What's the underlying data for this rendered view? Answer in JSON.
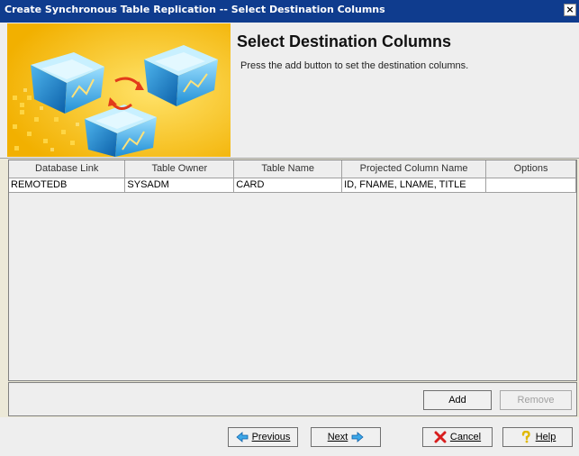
{
  "window": {
    "title": "Create Synchronous Table Replication -- Select Destination Columns",
    "close_glyph": "×"
  },
  "header": {
    "title": "Select Destination Columns",
    "description": "Press the add button to set the destination columns."
  },
  "table": {
    "columns": [
      "Database Link",
      "Table Owner",
      "Table Name",
      "Projected Column Name",
      "Options"
    ],
    "rows": [
      [
        "REMOTEDB",
        "SYSADM",
        "CARD",
        "ID, FNAME, LNAME, TITLE",
        ""
      ]
    ]
  },
  "actions": {
    "add_label": "Add",
    "remove_label": "Remove"
  },
  "nav": {
    "previous_label": "Previous",
    "next_label": "Next",
    "cancel_label": "Cancel",
    "help_label": "Help"
  },
  "icons": {
    "previous": "arrow-left-icon",
    "next": "arrow-right-icon",
    "cancel": "red-x-icon",
    "help": "question-icon"
  },
  "colors": {
    "titlebar": "#0f3c8e",
    "banner": "#f5c300",
    "accent": "#3ea8e8"
  }
}
